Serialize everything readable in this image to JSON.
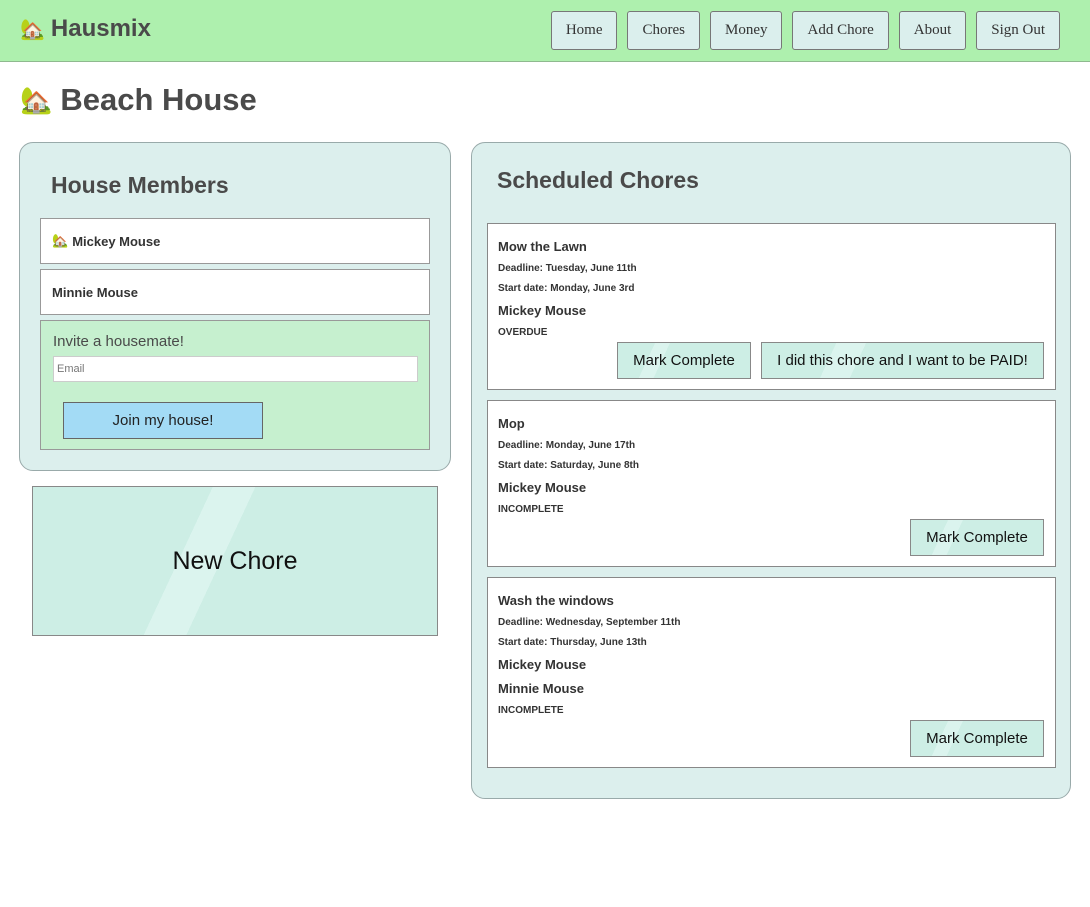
{
  "navbar": {
    "brand_icon": "🏡",
    "brand": "Hausmix",
    "links": [
      "Home",
      "Chores",
      "Money",
      "Add Chore",
      "About",
      "Sign Out"
    ]
  },
  "page": {
    "title_icon": "🏡",
    "title": "Beach House"
  },
  "members": {
    "title": "House Members",
    "list": [
      {
        "icon": "🏡",
        "name": "Mickey Mouse"
      },
      {
        "icon": "",
        "name": "Minnie Mouse"
      }
    ],
    "invite": {
      "label": "Invite a housemate!",
      "placeholder": "Email",
      "value": "",
      "button": "Join my house!"
    }
  },
  "new_chore": {
    "label": "New Chore"
  },
  "chores": {
    "title": "Scheduled Chores",
    "items": [
      {
        "name": "Mow the Lawn",
        "deadline": "Deadline: Tuesday, June 11th",
        "start": "Start date: Monday, June 3rd",
        "people": [
          "Mickey Mouse"
        ],
        "status": "OVERDUE",
        "buttons": [
          "Mark Complete",
          "I did this chore and I want to be PAID!"
        ]
      },
      {
        "name": "Mop",
        "deadline": "Deadline: Monday, June 17th",
        "start": "Start date: Saturday, June 8th",
        "people": [
          "Mickey Mouse"
        ],
        "status": "INCOMPLETE",
        "buttons": [
          "Mark Complete"
        ]
      },
      {
        "name": "Wash the windows",
        "deadline": "Deadline: Wednesday, September 11th",
        "start": "Start date: Thursday, June 13th",
        "people": [
          "Mickey Mouse",
          "Minnie Mouse"
        ],
        "status": "INCOMPLETE",
        "buttons": [
          "Mark Complete"
        ]
      }
    ]
  },
  "colors": {
    "navbar": "#aef0ae",
    "panel": "#dcefed",
    "invite": "#c6f0cf",
    "join_button": "#a3dbf5",
    "chore_button": "#cdeee5"
  }
}
